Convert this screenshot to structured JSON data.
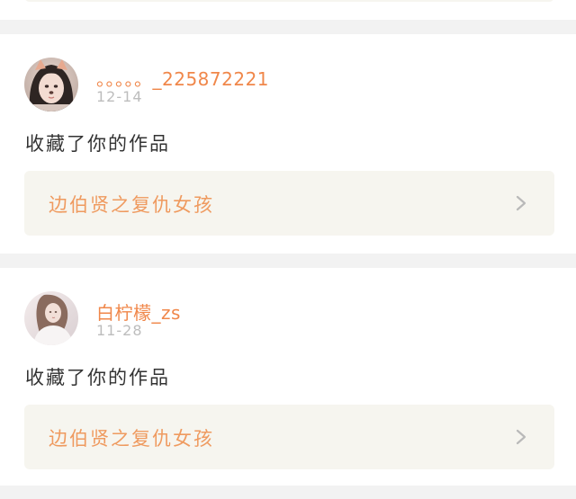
{
  "feed": {
    "items": [
      {
        "username": "。。。。。_225872221",
        "date": "12-14",
        "action_text": "收藏了你的作品",
        "work_title": "边伯贤之复仇女孩",
        "avatar_icon": "user-avatar-cat-filter"
      },
      {
        "username": "白柠檬_zs",
        "date": "11-28",
        "action_text": "收藏了你的作品",
        "work_title": "边伯贤之复仇女孩",
        "avatar_icon": "user-avatar-photo"
      }
    ]
  },
  "colors": {
    "username": "#f0874a",
    "work_title": "#ef9a5f",
    "date": "#bdbdbd",
    "page_bg": "#f2f2f2",
    "work_box_bg": "#f6f5ef"
  }
}
